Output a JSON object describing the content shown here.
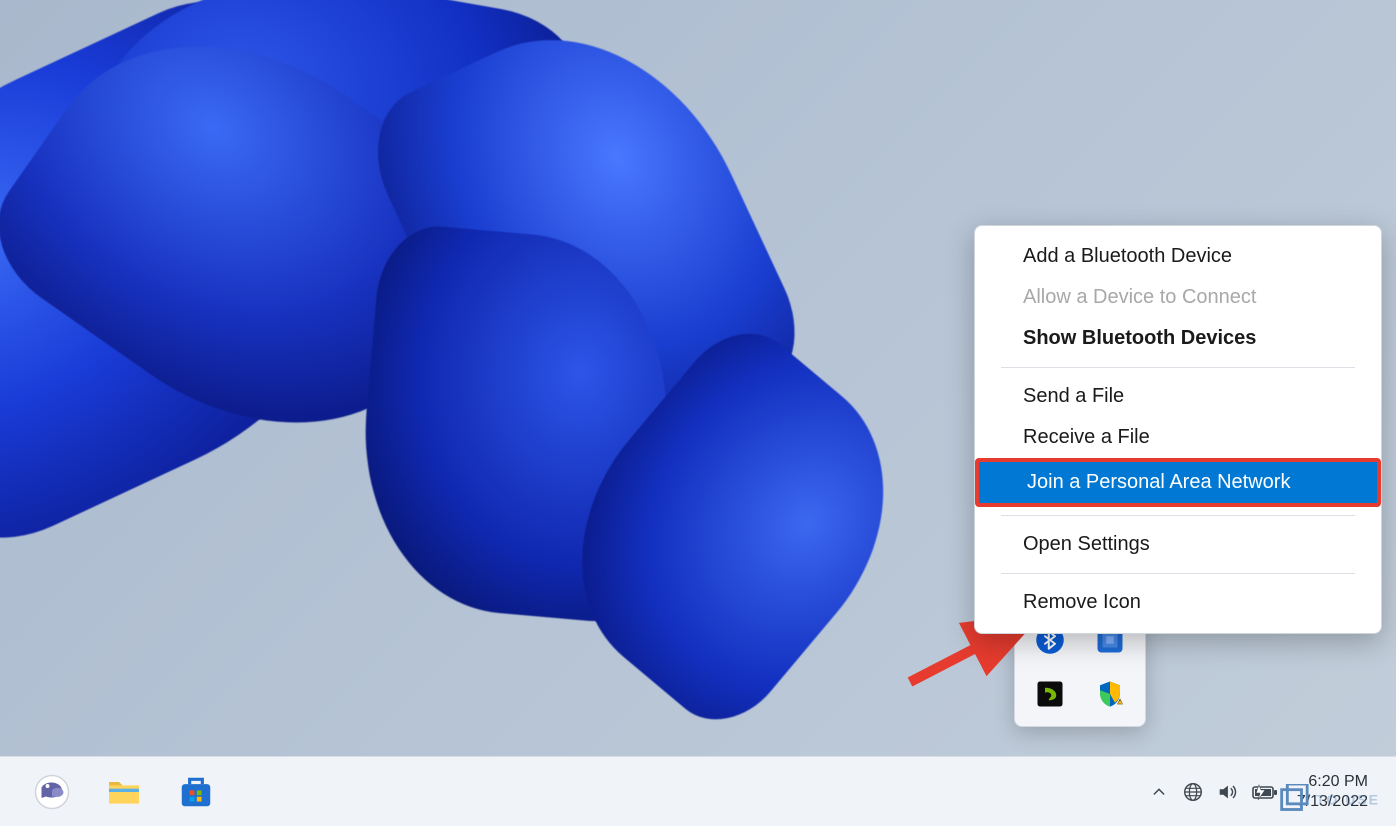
{
  "context_menu": {
    "items": [
      {
        "label": "Add a Bluetooth Device",
        "state": "normal"
      },
      {
        "label": "Allow a Device to Connect",
        "state": "disabled"
      },
      {
        "label": "Show Bluetooth Devices",
        "state": "bold"
      }
    ],
    "items2": [
      {
        "label": "Send a File",
        "state": "normal"
      },
      {
        "label": "Receive a File",
        "state": "normal"
      }
    ],
    "highlighted": {
      "label": "Join a Personal Area Network"
    },
    "items3": [
      {
        "label": "Open Settings",
        "state": "normal"
      }
    ],
    "items4": [
      {
        "label": "Remove Icon",
        "state": "normal"
      }
    ]
  },
  "tray_popup": {
    "icons": [
      {
        "name": "bluetooth-icon",
        "color": "#0a5cd6"
      },
      {
        "name": "intel-graphics-icon",
        "color": "#1e6bd6"
      },
      {
        "name": "nvidia-icon",
        "color": "#76b900"
      },
      {
        "name": "windows-security-icon",
        "color": "#0067c0"
      }
    ]
  },
  "taskbar": {
    "left_icons": [
      {
        "name": "chat-icon"
      },
      {
        "name": "file-explorer-icon"
      },
      {
        "name": "microsoft-store-icon"
      }
    ],
    "system_icons": [
      {
        "name": "chevron-up-icon"
      },
      {
        "name": "language-icon"
      },
      {
        "name": "volume-icon"
      },
      {
        "name": "battery-icon"
      }
    ],
    "clock": {
      "time": "6:20 PM",
      "date": "7/13/2022"
    }
  },
  "annotation": {
    "arrow_color": "#e63b2e",
    "highlight_color": "#e63b2e"
  },
  "watermark": {
    "text": "TO USE"
  }
}
